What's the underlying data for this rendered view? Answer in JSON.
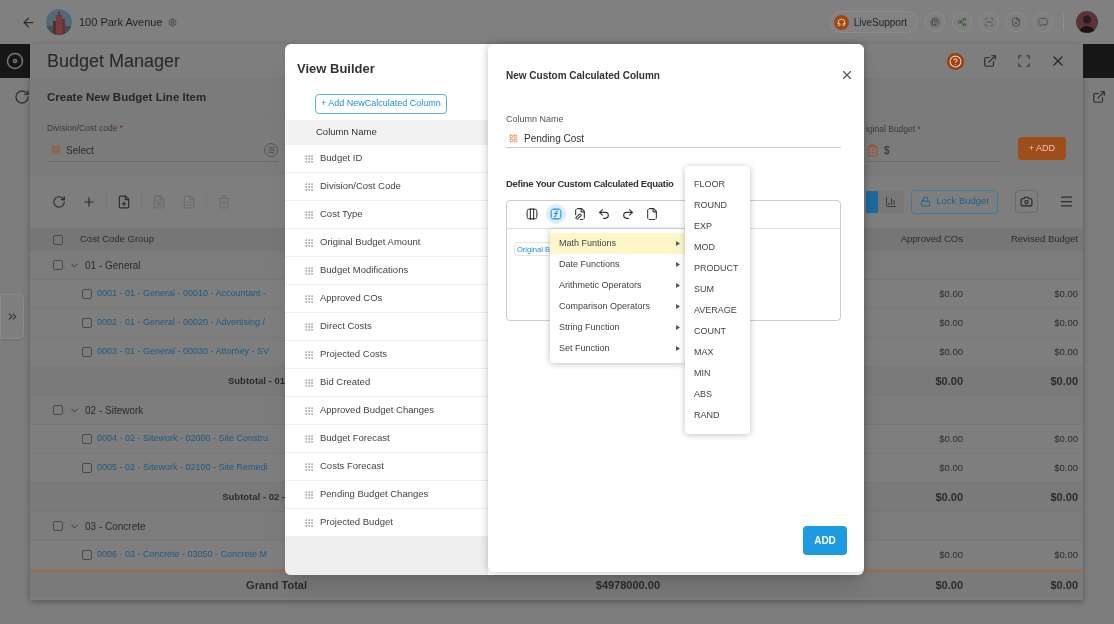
{
  "top_bar": {
    "project_name": "100 Park Avenue",
    "live_support": "LiveSupport"
  },
  "budget_manager": {
    "title": "Budget Manager",
    "form": {
      "title": "Create New Budget Line Item",
      "division_label": "Division/Cost code",
      "division_required_mark": "*",
      "division_placeholder": "Select",
      "original_budget_label": "iginal Budget",
      "original_budget_required_mark": "*",
      "original_budget_value": "$",
      "add_button": "+ ADD"
    },
    "tool_groups": [
      [
        {
          "kind": "refresh",
          "disabled": false
        },
        {
          "kind": "add",
          "disabled": false
        }
      ],
      [
        {
          "kind": "file",
          "disabled": false
        }
      ],
      [
        {
          "kind": "pdf",
          "disabled": true
        },
        {
          "kind": "sheet",
          "disabled": true
        }
      ],
      [
        {
          "kind": "delete",
          "disabled": true
        }
      ]
    ],
    "view_toggle": [
      {
        "kind": "table",
        "selected": true
      },
      {
        "kind": "chart",
        "selected": false
      }
    ],
    "lock_button": "Lock Budget",
    "table": {
      "header_checked": false,
      "columns": [
        "Cost Code Group",
        "Approved COs",
        "Revised Budget"
      ],
      "rows": [
        {
          "kind": "group",
          "label": "01 - General",
          "checked": false,
          "expanded": true
        },
        {
          "kind": "item",
          "label": "0001 - 01 - General - 00010 - Accountant -",
          "checked": false,
          "approved_cos": "$0.00",
          "revised_budget": "$0.00"
        },
        {
          "kind": "item",
          "label": "0002 - 01 - General - 00020 - Advertising /",
          "checked": false,
          "approved_cos": "$0.00",
          "revised_budget": "$0.00"
        },
        {
          "kind": "item",
          "label": "0003 - 01 - General - 00030 - Attorney - SV",
          "checked": false,
          "approved_cos": "$0.00",
          "revised_budget": "$0.00"
        },
        {
          "kind": "subtotal",
          "label": "Subtotal - 01",
          "approved_cos": "$0.00",
          "revised_budget": "$0.00"
        },
        {
          "kind": "group",
          "label": "02 - Sitework",
          "checked": false,
          "expanded": true
        },
        {
          "kind": "item",
          "label": "0004 - 02 - Sitework - 02000 - Site Constru",
          "checked": false,
          "approved_cos": "$0.00",
          "revised_budget": "$0.00"
        },
        {
          "kind": "item",
          "label": "0005 - 02 - Sitework - 02100 - Site Remedi",
          "checked": false,
          "approved_cos": "$0.00",
          "revised_budget": "$0.00"
        },
        {
          "kind": "subtotal",
          "label": "Subtotal - 02 -",
          "approved_cos": "$0.00",
          "revised_budget": "$0.00"
        },
        {
          "kind": "group",
          "label": "03 - Concrete",
          "checked": false,
          "expanded": true
        },
        {
          "kind": "item",
          "label": "0006 - 03 - Concrete - 03050 - Concrete M",
          "checked": false,
          "approved_cos": "$0.00",
          "revised_budget": "$0.00"
        },
        {
          "kind": "grand_total",
          "label": "Grand Total",
          "amount": "$4978000.00",
          "approved_cos": "$0.00",
          "revised_budget": "$0.00"
        }
      ]
    }
  },
  "view_builder": {
    "title": "View Builder",
    "add_button": "+ Add NewCalculated Column",
    "column_header": "Column Name",
    "columns": [
      "Budget ID",
      "Division/Cost Code",
      "Cost Type",
      "Original Budget Amount",
      "Budget Modifications",
      "Approved COs",
      "Direct Costs",
      "Projected Costs",
      "Bid Created",
      "Approved Budget Changes",
      "Budget Forecast",
      "Costs Forecast",
      "Pending Budget Changes",
      "Projected Budget"
    ]
  },
  "custom_column_dialog": {
    "title": "New Custom Calculated Column",
    "column_name_label": "Column Name",
    "column_name_value": "Pending Cost",
    "equation_label": "Define Your Custom Calculated Equatio",
    "editor_tools": [
      {
        "kind": "columns",
        "selected": false
      },
      {
        "kind": "function",
        "selected": true
      },
      {
        "kind": "edit",
        "selected": false
      },
      {
        "kind": "undo",
        "selected": false
      },
      {
        "kind": "redo",
        "selected": false
      },
      {
        "kind": "document",
        "selected": false
      }
    ],
    "equation_chip": "Original B",
    "menu": [
      {
        "label": "Math Funtions",
        "selected": true
      },
      {
        "label": "Date Functions",
        "selected": false
      },
      {
        "label": "Arithmetic Operators",
        "selected": false
      },
      {
        "label": "Comparison Operators",
        "selected": false
      },
      {
        "label": "String Function",
        "selected": false
      },
      {
        "label": "Set Function",
        "selected": false
      }
    ],
    "submenu": [
      "FLOOR",
      "ROUND",
      "EXP",
      "MOD",
      "PRODUCT",
      "SUM",
      "AVERAGE",
      "COUNT",
      "MAX",
      "MIN",
      "ABS",
      "RAND"
    ],
    "add_button": "ADD"
  }
}
